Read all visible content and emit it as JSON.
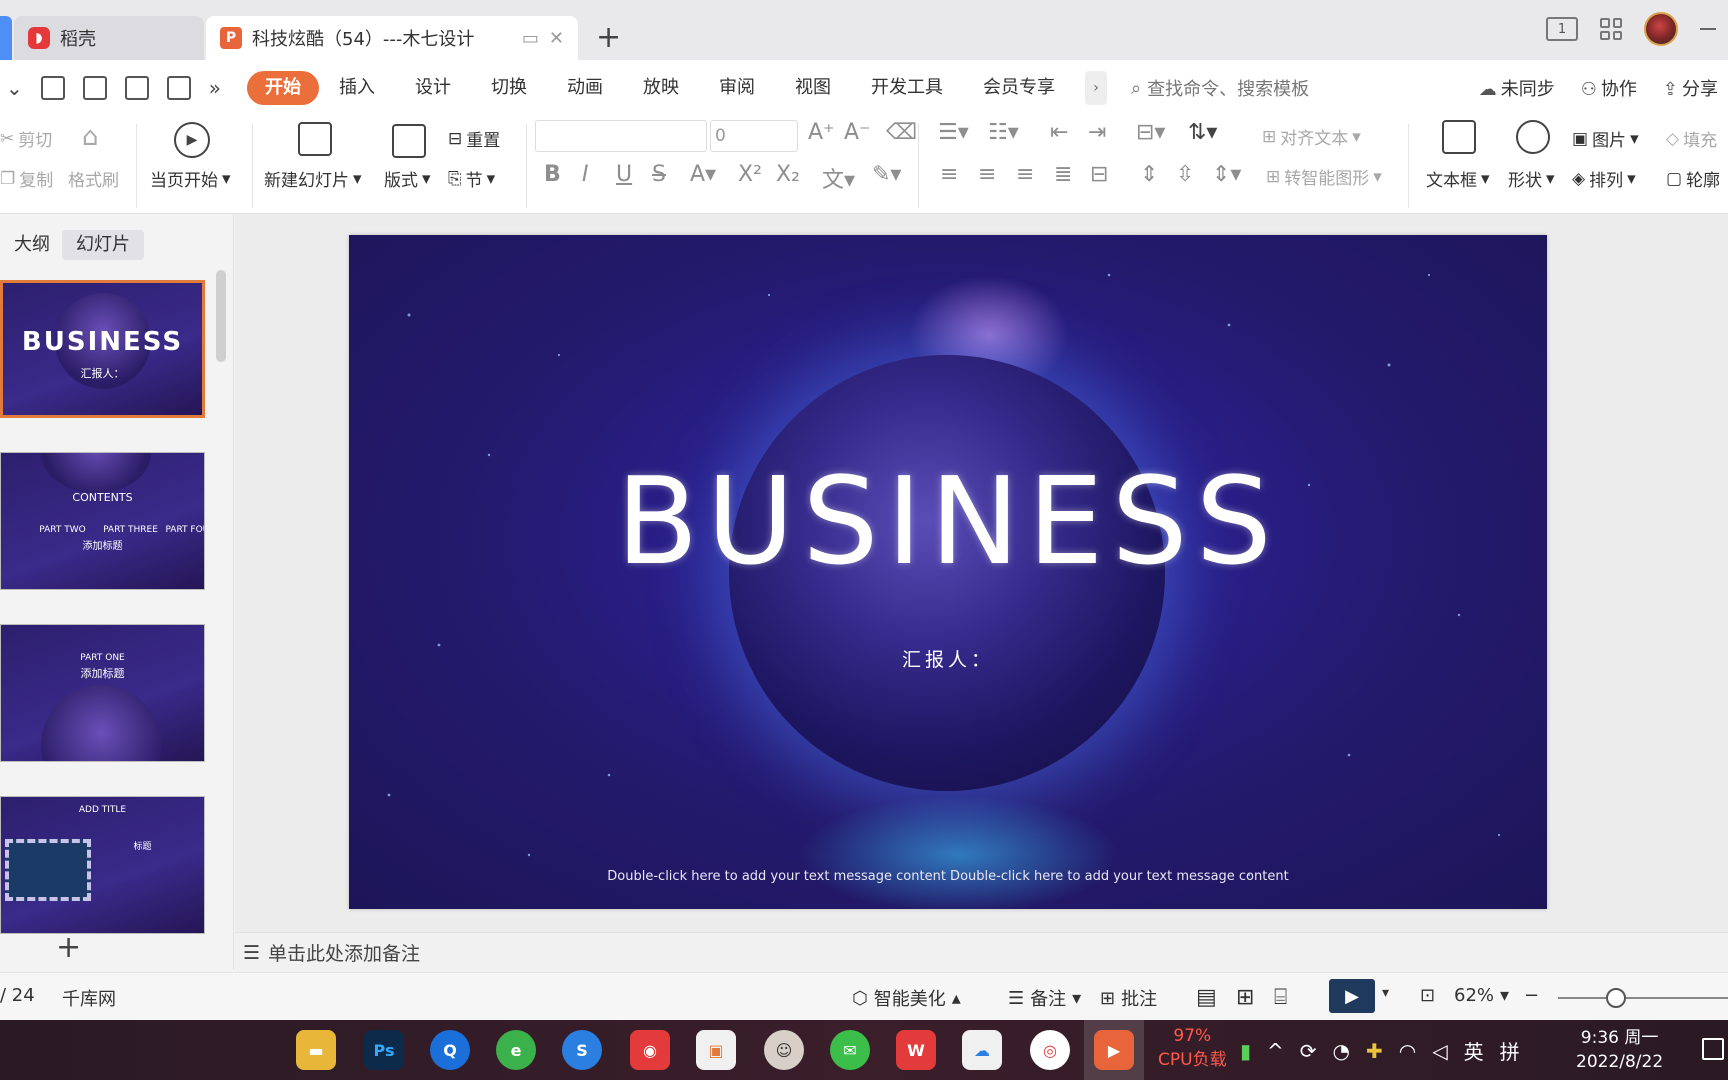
{
  "tabs": {
    "inactive_label": "稻壳",
    "active_label": "科技炫酷（54）---木七设计"
  },
  "menu": {
    "tabs": [
      "开始",
      "插入",
      "设计",
      "切换",
      "动画",
      "放映",
      "审阅",
      "视图",
      "开发工具",
      "会员专享"
    ],
    "search_placeholder": "查找命令、搜索模板",
    "sync": "未同步",
    "collab": "协作",
    "share": "分享"
  },
  "ribbon": {
    "cut": "剪切",
    "copy": "复制",
    "format_painter": "格式刷",
    "start_from_current": "当页开始",
    "new_slide": "新建幻灯片",
    "layout": "版式",
    "reset": "重置",
    "section": "节",
    "font_size": "0",
    "align_text": "对齐文本",
    "smart_shape": "转智能图形",
    "textbox": "文本框",
    "shape": "形状",
    "picture": "图片",
    "arrange": "排列",
    "fill": "填充",
    "outline": "轮廓"
  },
  "left_pane": {
    "outline_tab": "大纲",
    "slides_tab": "幻灯片",
    "thumbs": [
      {
        "title": "BUSINESS",
        "sub": "汇报人："
      },
      {
        "title": "CONTENTS",
        "parts": [
          "PART TWO",
          "PART THREE",
          "PART FOUR"
        ],
        "heading": "添加标题"
      },
      {
        "title": "PART ONE",
        "heading": "添加标题"
      },
      {
        "title": "ADD TITLE",
        "heading": "标题"
      }
    ]
  },
  "slide": {
    "title": "BUSINESS",
    "reporter": "汇报人：",
    "footer": "Double-click here to add your text message content Double-click here to add your text message content"
  },
  "notes": {
    "placeholder": "单击此处添加备注"
  },
  "status": {
    "page": "/ 24",
    "source": "千库网",
    "beautify": "智能美化",
    "notes": "备注",
    "comment": "批注",
    "zoom": "62%"
  },
  "taskbar": {
    "cpu_percent": "97%",
    "cpu_label": "CPU负载",
    "ime_lang": "英",
    "ime_mode": "拼",
    "time": "9:36 周一",
    "date": "2022/8/22"
  },
  "colors": {
    "accent": "#ea6f3a",
    "slide_bg": "#2a1f8a",
    "play_button": "#1f3a5c"
  }
}
